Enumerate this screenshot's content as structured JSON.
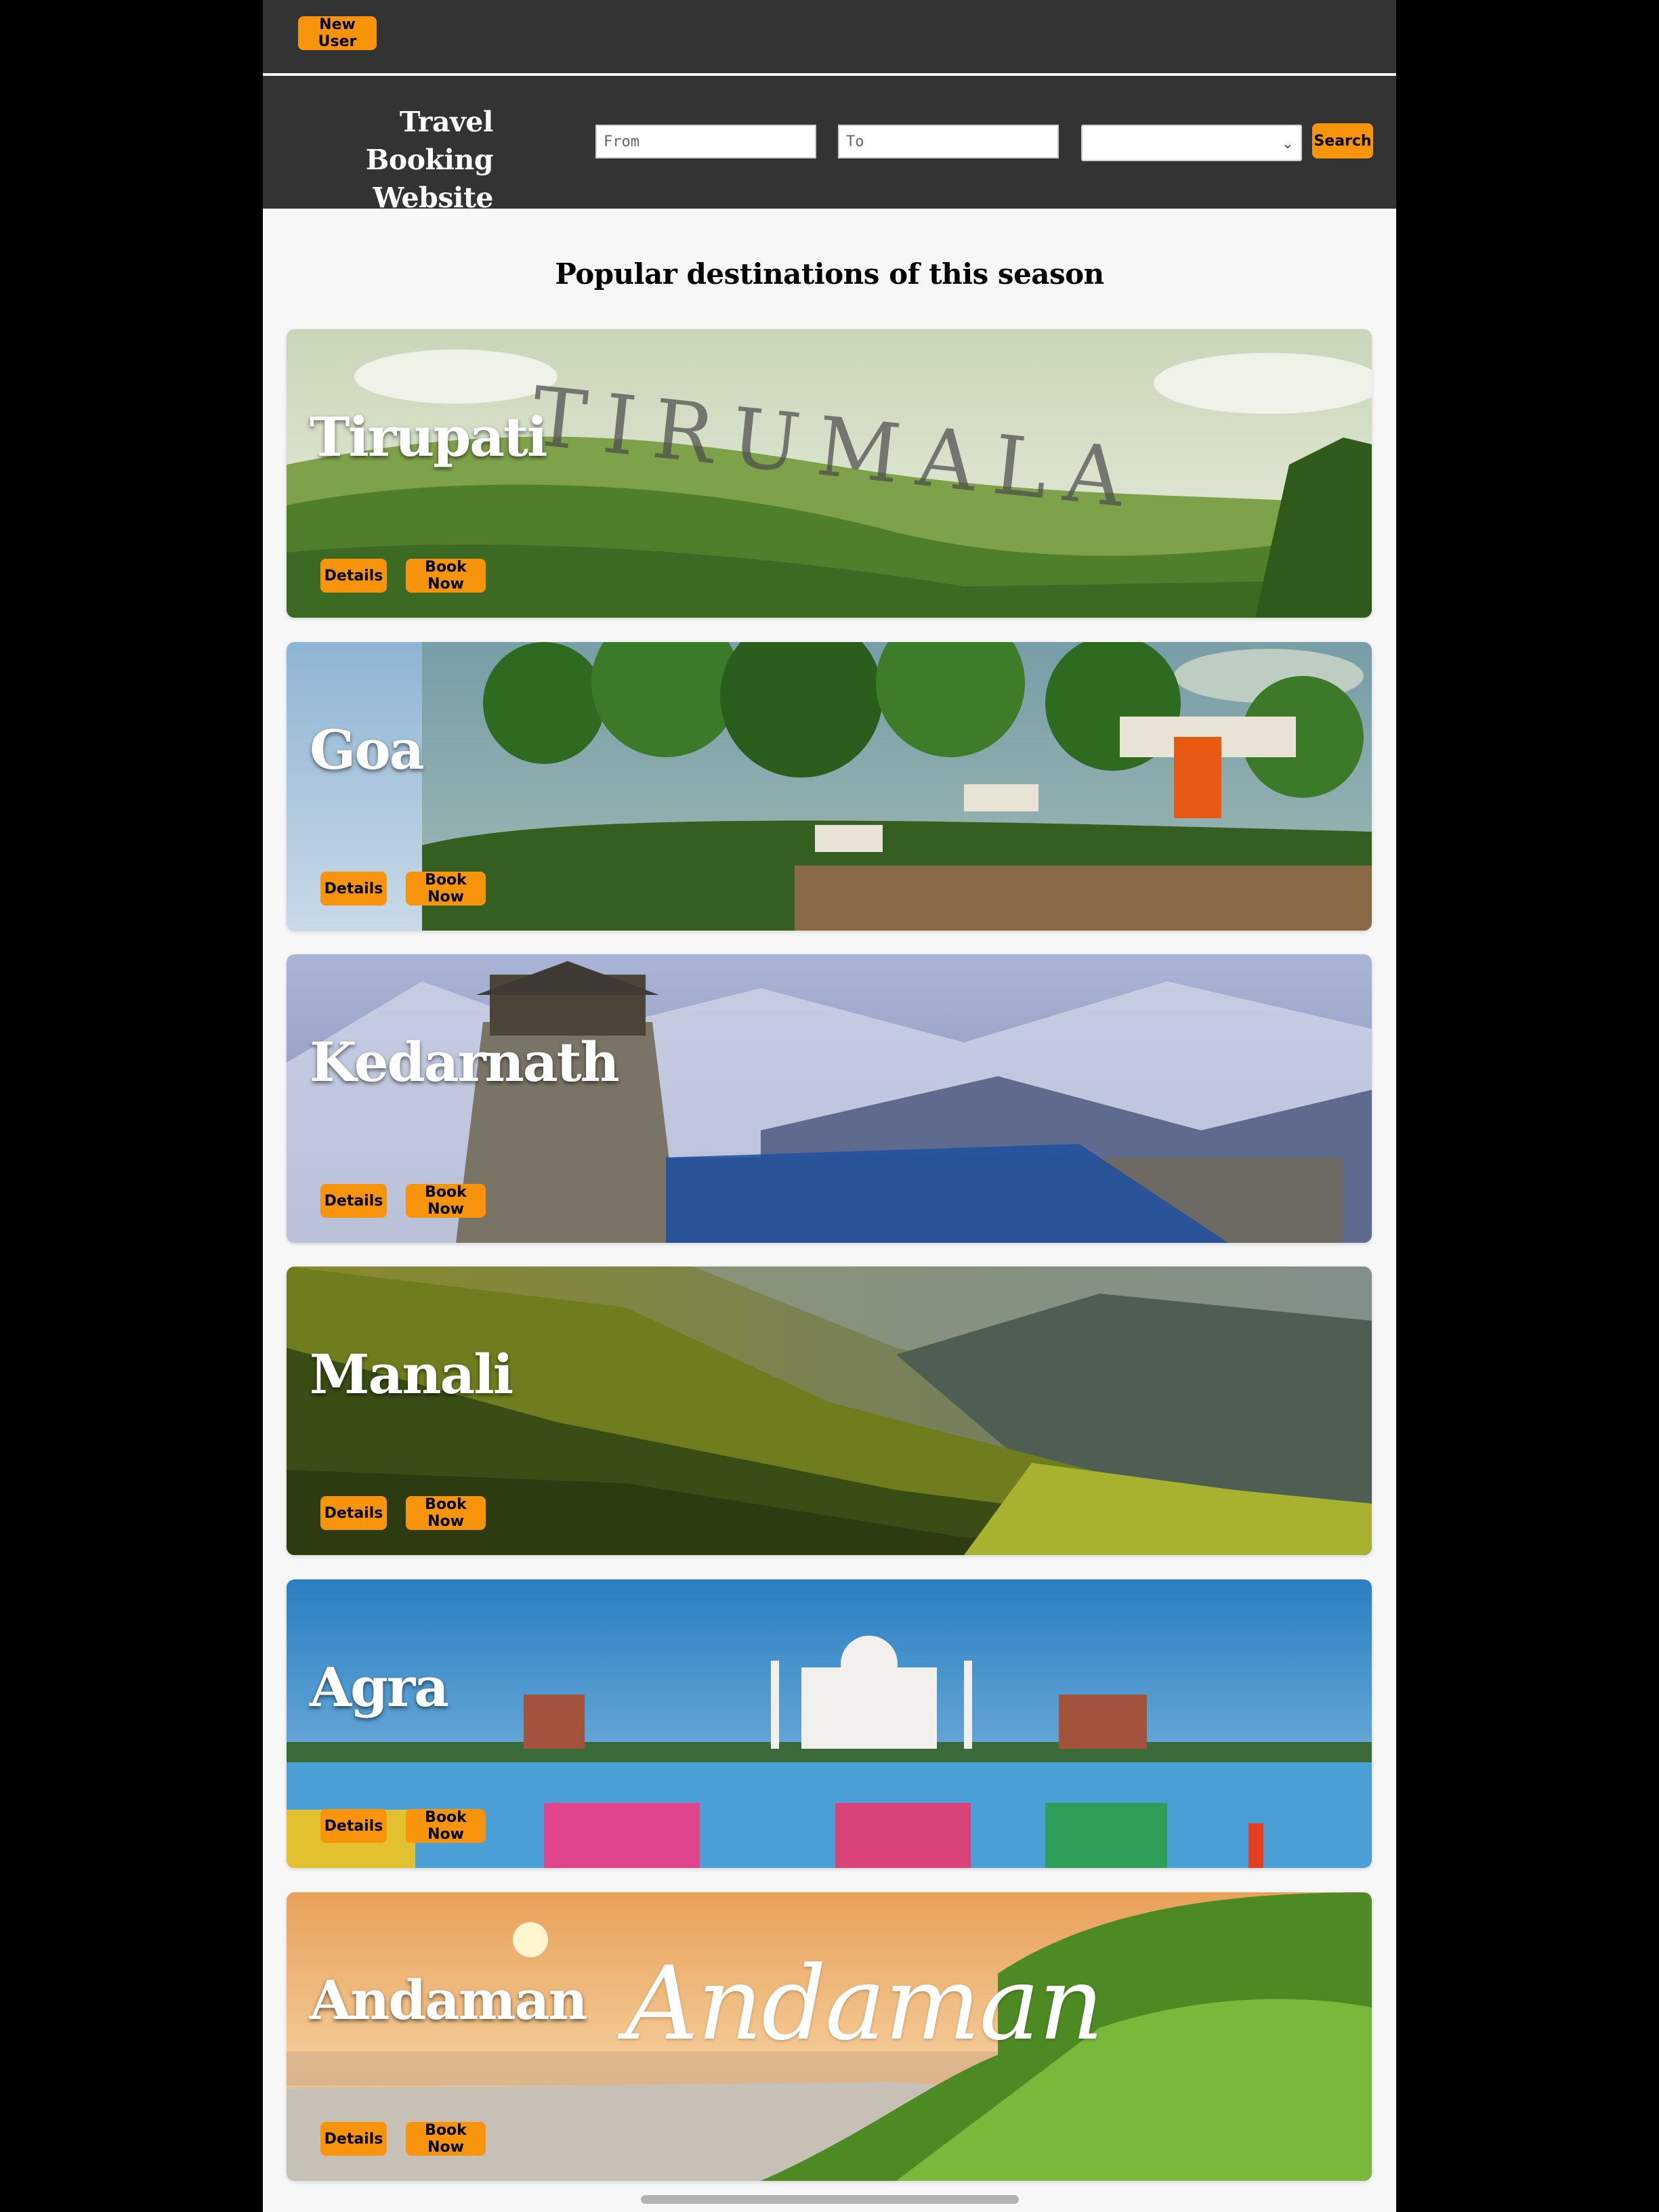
{
  "topbar": {
    "new_user_label": "New User"
  },
  "header": {
    "title_line1": "Travel Booking",
    "title_line2": "Website",
    "from_placeholder": "From",
    "to_placeholder": "To",
    "select_value": "",
    "search_label": "Search"
  },
  "main": {
    "section_title": "Popular destinations of this season",
    "details_label": "Details",
    "book_label": "Book Now",
    "destinations": [
      {
        "name": "Tirupati",
        "overlay_text": "TIRUMALA"
      },
      {
        "name": "Goa"
      },
      {
        "name": "Kedarnath"
      },
      {
        "name": "Manali"
      },
      {
        "name": "Agra"
      },
      {
        "name": "Andaman",
        "overlay_text": "Andaman"
      }
    ]
  },
  "colors": {
    "bar_bg": "#333333",
    "accent": "#f7940c",
    "page_bg": "#f7f7f7"
  }
}
